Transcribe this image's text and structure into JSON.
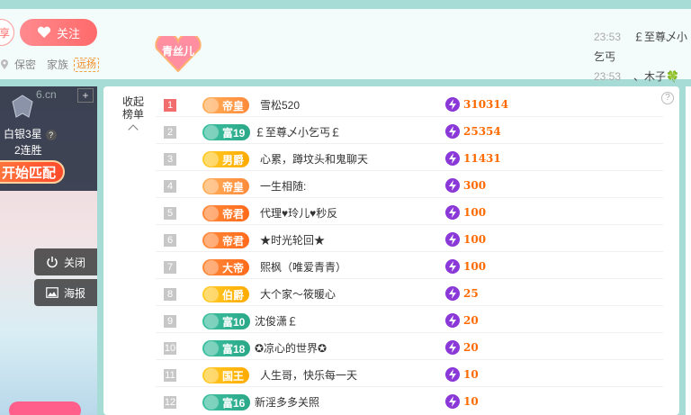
{
  "header": {
    "left_pill_label": "享",
    "follow_label": "关注",
    "location": "保密",
    "family_label": "家族",
    "family_tag": "远扬",
    "fan_badge_label": "青丝儿"
  },
  "chat": [
    {
      "time": "23:53",
      "text": "￡至尊乄小乞丐"
    },
    {
      "time": "23:53",
      "text": "、木子🍀 诶"
    }
  ],
  "video": {
    "watermark": "6.cn",
    "plus_label": "+",
    "rank_name": "白银3星",
    "help_label": "?",
    "wins_label": "2连胜",
    "match_button": "开始匹配",
    "close_button": "关闭",
    "poster_button": "海报"
  },
  "panel": {
    "collapse_label": "收起榜单",
    "help_label": "?",
    "rows": [
      {
        "rank": "1",
        "badge": "帝皇",
        "name": "雪松520",
        "value": "310314"
      },
      {
        "rank": "2",
        "badge": "富19",
        "name": "￡至尊乄小乞丐￡",
        "value": "25354"
      },
      {
        "rank": "3",
        "badge": "男爵",
        "name": "心累，蹲坟头和鬼聊天",
        "value": "11431"
      },
      {
        "rank": "4",
        "badge": "帝皇",
        "name": "一生相随:",
        "value": "300"
      },
      {
        "rank": "5",
        "badge": "帝君",
        "name": "代理♥玲儿♥秒反",
        "value": "100"
      },
      {
        "rank": "6",
        "badge": "帝君",
        "name": "★时光轮回★",
        "value": "100"
      },
      {
        "rank": "7",
        "badge": "大帝",
        "name": "熙枫（唯爱青青）",
        "value": "100"
      },
      {
        "rank": "8",
        "badge": "伯爵",
        "name": "大个家～筱暖心",
        "value": "25"
      },
      {
        "rank": "9",
        "badge": "富10",
        "name": "沈俊潇￡",
        "value": "20"
      },
      {
        "rank": "10",
        "badge": "富18",
        "name": "✪凉心的世界✪",
        "value": "20"
      },
      {
        "rank": "11",
        "badge": "国王",
        "name": "人生哥，快乐每一天",
        "value": "10"
      },
      {
        "rank": "12",
        "badge": "富16",
        "name": "新淫多多关照",
        "value": "10"
      }
    ]
  },
  "colors": {
    "rank_top": "#f26d6d",
    "value_text": "#ff6a00",
    "bolt": "#8a38d8",
    "page_bg": "#a7dcd6"
  }
}
